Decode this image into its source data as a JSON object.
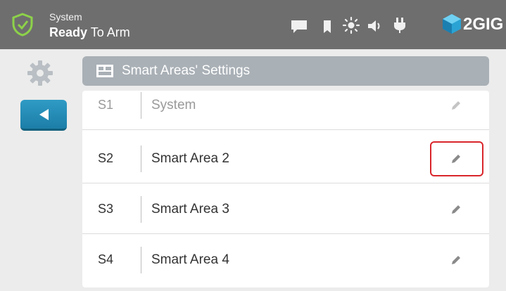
{
  "topbar": {
    "status_label": "System",
    "status_strong": "Ready",
    "status_rest": " To Arm",
    "brand": "2GIG",
    "icons": [
      "shield-check-icon",
      "message-icon",
      "bookmark-icon",
      "brightness-icon",
      "volume-icon",
      "power-plug-icon",
      "2gig-logo-icon"
    ]
  },
  "sidebar": {
    "icons": [
      "gear-icon",
      "back-arrow-icon"
    ]
  },
  "panel": {
    "title": "Smart Areas' Settings",
    "icon": "smart-area-icon"
  },
  "areas": [
    {
      "code": "S1",
      "name": "System",
      "dim": true
    },
    {
      "code": "S2",
      "name": "Smart Area 2",
      "dim": false
    },
    {
      "code": "S3",
      "name": "Smart Area 3",
      "dim": false
    },
    {
      "code": "S4",
      "name": "Smart Area 4",
      "dim": false
    }
  ],
  "colors": {
    "topbar": "#6e6e6e",
    "accent": "#1c7ea8",
    "shield": "#8dd14a",
    "highlight": "#d9262b"
  }
}
